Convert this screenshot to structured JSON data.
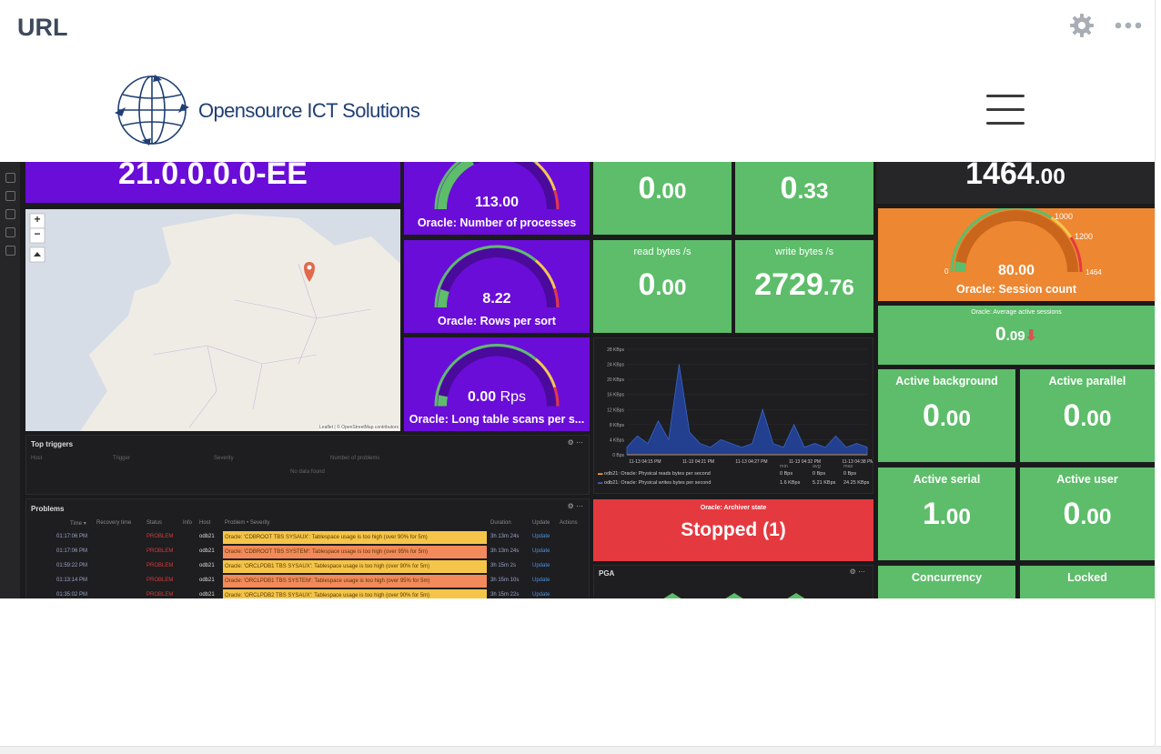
{
  "header": {
    "url_label": "URL",
    "settings_icon": "gear-icon",
    "more_icon": "more-dots-icon"
  },
  "brand": {
    "name": "Opensource ICT Solutions",
    "logo_icon": "globe-logo-icon"
  },
  "nav": {
    "menu_icon": "hamburger-menu-icon"
  },
  "dashboard": {
    "version": {
      "value": "21.0.0.0.0-EE"
    },
    "gauge_processes": {
      "value": "113.00",
      "title": "Oracle: Number of processes",
      "level": 0.35
    },
    "gauge_rows_sort": {
      "value": "8.22",
      "title": "Oracle: Rows per sort",
      "level": 0.1
    },
    "gauge_long_scans": {
      "value": "0.00",
      "unit": "Rps",
      "title": "Oracle: Long table scans per s...",
      "level": 0.02
    },
    "stat_a": {
      "int": "0",
      "dec": ".00"
    },
    "stat_b": {
      "int": "0",
      "dec": ".33"
    },
    "read_bytes": {
      "label": "read bytes /s",
      "int": "0",
      "dec": ".00"
    },
    "write_bytes": {
      "label": "write bytes /s",
      "int": "2729",
      "dec": ".76"
    },
    "top_stat": {
      "int": "1464",
      "dec": ".00"
    },
    "session_count": {
      "value": "80.00",
      "title": "Oracle: Session count",
      "min": "0",
      "t1": "1000",
      "t2": "1200",
      "max": "1464",
      "level": 0.055
    },
    "avg_sessions": {
      "title": "Oracle: Average active sessions",
      "int": "0",
      "dec": ".09"
    },
    "active_background": {
      "label": "Active background",
      "int": "0",
      "dec": ".00"
    },
    "active_parallel": {
      "label": "Active parallel",
      "int": "0",
      "dec": ".00"
    },
    "active_serial": {
      "label": "Active serial",
      "int": "1",
      "dec": ".00"
    },
    "active_user": {
      "label": "Active user",
      "int": "0",
      "dec": ".00"
    },
    "concurrency": {
      "label": "Concurrency"
    },
    "locked": {
      "label": "Locked"
    },
    "archiver": {
      "title": "Oracle: Archiver state",
      "value": "Stopped (1)"
    },
    "pga": {
      "title": "PGA"
    },
    "map": {
      "zoom_in": "+",
      "zoom_out": "−",
      "attribution": "Leaflet | © OpenStreetMap contributors"
    },
    "top_triggers": {
      "title": "Top triggers",
      "columns": [
        "Host",
        "Trigger",
        "Severity",
        "Number of problems"
      ],
      "empty": "No data found"
    },
    "problems": {
      "title": "Problems",
      "columns": [
        "Time ▾",
        "Recovery time",
        "Status",
        "Info",
        "Host",
        "Problem • Severity",
        "Duration",
        "Update",
        "Actions"
      ],
      "rows": [
        {
          "time": "01:17:06 PM",
          "status": "PROBLEM",
          "host": "odb21",
          "msg": "Oracle: 'CDBROOT TBS SYSAUX': Tablespace usage is too high (over 90% for 5m)",
          "duration": "3h 13m 24s",
          "update": "Update",
          "color": "#f5c54a"
        },
        {
          "time": "01:17:06 PM",
          "status": "PROBLEM",
          "host": "odb21",
          "msg": "Oracle: 'CDBROOT TBS SYSTEM': Tablespace usage is too high (over 95% for 5m)",
          "duration": "3h 13m 24s",
          "update": "Update",
          "color": "#f28a5b"
        },
        {
          "time": "01:59:22 PM",
          "status": "PROBLEM",
          "host": "odb21",
          "msg": "Oracle: 'ORCLPDB1 TBS SYSAUX': Tablespace usage is too high (over 90% for 5m)",
          "duration": "3h 15m 2s",
          "update": "Update",
          "color": "#f5c54a"
        },
        {
          "time": "01:13:14 PM",
          "status": "PROBLEM",
          "host": "odb21",
          "msg": "Oracle: 'ORCLPDB1 TBS SYSTEM': Tablespace usage is too high (over 95% for 5m)",
          "duration": "3h 15m 10s",
          "update": "Update",
          "color": "#f28a5b"
        },
        {
          "time": "01:35:02 PM",
          "status": "PROBLEM",
          "host": "odb21",
          "msg": "Oracle: 'ORCLPDB2 TBS SYSAUX': Tablespace usage is too high (over 90% for 5m)",
          "duration": "3h 15m 22s",
          "update": "Update",
          "color": "#f5c54a"
        }
      ]
    },
    "io_chart": {
      "y_ticks": [
        "28 KBps",
        "24 KBps",
        "20 KBps",
        "16 KBps",
        "12 KBps",
        "8 KBps",
        "4 KBps",
        "0 Bps"
      ],
      "x_ticks": [
        "11-13 04:15 PM",
        "11-13 04:21 PM",
        "11-13 04:27 PM",
        "11-13 04:32 PM",
        "11-13 04:38 PM"
      ],
      "legend": [
        {
          "name": "odb21: Oracle: Physical reads bytes per second",
          "color": "#f2a23a",
          "min": "0 Bps",
          "avg": "0 Bps",
          "max": "0 Bps"
        },
        {
          "name": "odb21: Oracle: Physical writes bytes per second",
          "color": "#3b63c9",
          "min": "1.6 KBps",
          "avg": "5.21 KBps",
          "max": "24.25 KBps"
        }
      ],
      "legend_cols": [
        "min",
        "avg",
        "max"
      ],
      "write_series": [
        2,
        5,
        3,
        9,
        4,
        24,
        6,
        3,
        2,
        4,
        3,
        2,
        3,
        12,
        3,
        2,
        8,
        2,
        3,
        2,
        5,
        2,
        3,
        2
      ]
    }
  },
  "colors": {
    "purple": "#6a0dd8",
    "green": "#5dbd6a",
    "orange": "#ee8731",
    "red": "#e53940",
    "dark": "#1e1e20"
  }
}
